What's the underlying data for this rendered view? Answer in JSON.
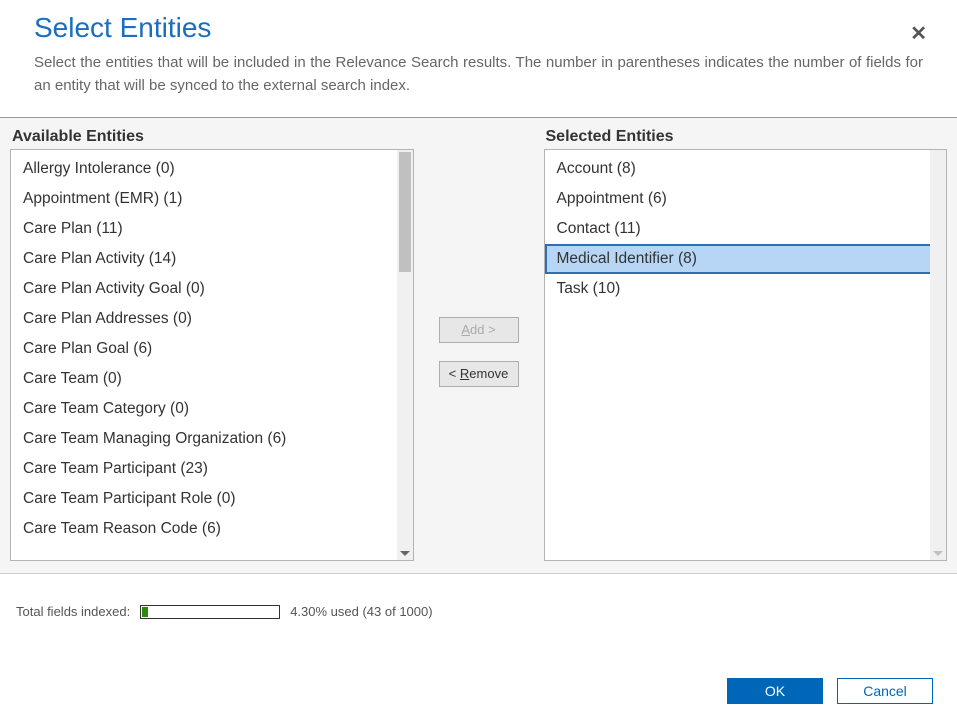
{
  "header": {
    "title": "Select Entities",
    "subtitle": "Select the entities that will be included in the Relevance Search results. The number in parentheses indicates the number of fields for an entity that will be synced to the external search index.",
    "close": "✕"
  },
  "labels": {
    "available": "Available Entities",
    "selected": "Selected Entities"
  },
  "available": [
    "Allergy Intolerance (0)",
    "Appointment (EMR) (1)",
    "Care Plan (11)",
    "Care Plan Activity (14)",
    "Care Plan Activity Goal (0)",
    "Care Plan Addresses (0)",
    "Care Plan Goal (6)",
    "Care Team (0)",
    "Care Team Category (0)",
    "Care Team Managing Organization (6)",
    "Care Team Participant (23)",
    "Care Team Participant Role (0)",
    "Care Team Reason Code (6)"
  ],
  "selected": [
    {
      "label": "Account (8)",
      "sel": false
    },
    {
      "label": "Appointment (6)",
      "sel": false
    },
    {
      "label": "Contact (11)",
      "sel": false
    },
    {
      "label": "Medical Identifier (8)",
      "sel": true
    },
    {
      "label": "Task (10)",
      "sel": false
    }
  ],
  "buttons": {
    "add": "Add >",
    "remove": "< Remove",
    "add_underline": "A",
    "remove_underline": "R"
  },
  "footer": {
    "label": "Total fields indexed:",
    "pct_text": "4.30% used (43 of 1000)",
    "pct": 4.3
  },
  "dialog": {
    "ok": "OK",
    "cancel": "Cancel"
  }
}
